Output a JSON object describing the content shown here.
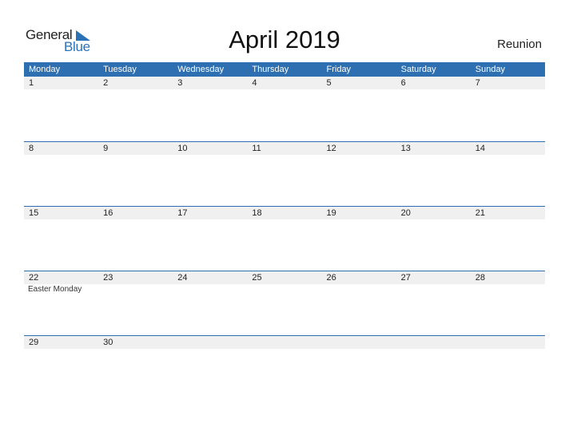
{
  "logo": {
    "word1": "General",
    "word2": "Blue"
  },
  "title": "April 2019",
  "region": "Reunion",
  "colors": {
    "accent": "#2d6fb1",
    "row_bg": "#f0f0f0"
  },
  "weekdays": [
    "Monday",
    "Tuesday",
    "Wednesday",
    "Thursday",
    "Friday",
    "Saturday",
    "Sunday"
  ],
  "weeks": [
    {
      "days": [
        "1",
        "2",
        "3",
        "4",
        "5",
        "6",
        "7"
      ],
      "events": [
        "",
        "",
        "",
        "",
        "",
        "",
        ""
      ]
    },
    {
      "days": [
        "8",
        "9",
        "10",
        "11",
        "12",
        "13",
        "14"
      ],
      "events": [
        "",
        "",
        "",
        "",
        "",
        "",
        ""
      ]
    },
    {
      "days": [
        "15",
        "16",
        "17",
        "18",
        "19",
        "20",
        "21"
      ],
      "events": [
        "",
        "",
        "",
        "",
        "",
        "",
        ""
      ]
    },
    {
      "days": [
        "22",
        "23",
        "24",
        "25",
        "26",
        "27",
        "28"
      ],
      "events": [
        "Easter Monday",
        "",
        "",
        "",
        "",
        "",
        ""
      ]
    },
    {
      "days": [
        "29",
        "30",
        "",
        "",
        "",
        "",
        ""
      ],
      "events": [
        "",
        "",
        "",
        "",
        "",
        "",
        ""
      ]
    }
  ]
}
